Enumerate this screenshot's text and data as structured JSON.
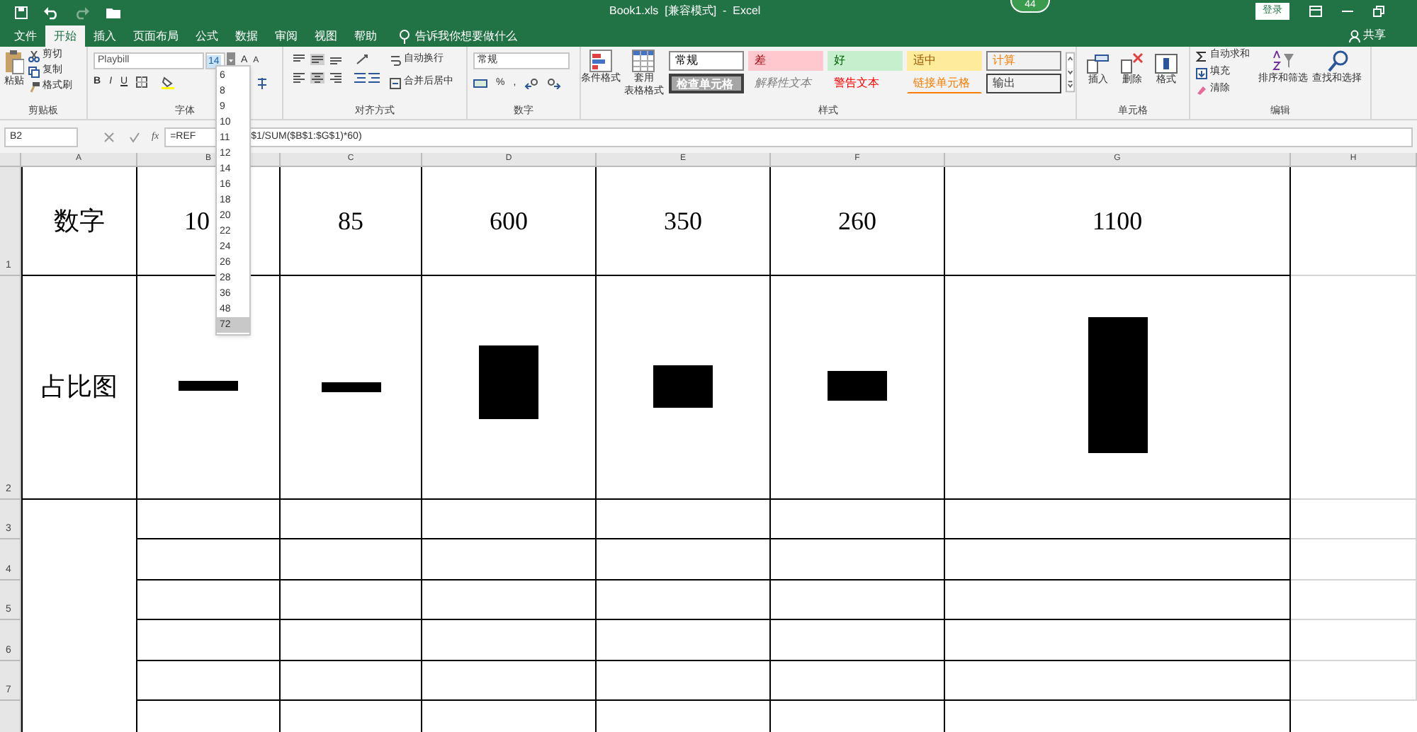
{
  "title_bar": {
    "title": "Book1.xls  [兼容模式]  -  Excel",
    "badge": "44",
    "sign_in": "登录"
  },
  "tabs": [
    {
      "label": "文件",
      "selected": false
    },
    {
      "label": "开始",
      "selected": true
    },
    {
      "label": "插入",
      "selected": false
    },
    {
      "label": "页面布局",
      "selected": false
    },
    {
      "label": "公式",
      "selected": false
    },
    {
      "label": "数据",
      "selected": false
    },
    {
      "label": "审阅",
      "selected": false
    },
    {
      "label": "视图",
      "selected": false
    },
    {
      "label": "帮助",
      "selected": false
    }
  ],
  "tell_me": {
    "placeholder": "告诉我你想要做什么"
  },
  "share": "共享",
  "ribbon": {
    "clipboard": {
      "label": "剪贴板",
      "paste": "粘贴",
      "cut": "剪切",
      "copy": "复制",
      "format_painter": "格式刷"
    },
    "font": {
      "label": "字体",
      "font_name": "Playbill",
      "font_size": "14",
      "bold": "B",
      "italic": "I",
      "underline": "U",
      "grow": "A",
      "shrink": "A"
    },
    "alignment": {
      "label": "对齐方式",
      "wrap": "自动换行",
      "merge": "合并后居中"
    },
    "number": {
      "label": "数字",
      "format": "常规",
      "percent": "%",
      "comma": ","
    },
    "styles": {
      "label": "样式",
      "conditional": "条件格式",
      "table_line1": "套用",
      "table_line2": "表格格式",
      "gallery": [
        {
          "label": "常规",
          "kind": "normal"
        },
        {
          "label": "差",
          "kind": "bad"
        },
        {
          "label": "好",
          "kind": "good"
        },
        {
          "label": "适中",
          "kind": "neutral"
        },
        {
          "label": "计算",
          "kind": "calculation"
        },
        {
          "label": "检查单元格",
          "kind": "check"
        },
        {
          "label": "解释性文本",
          "kind": "explanatory"
        },
        {
          "label": "警告文本",
          "kind": "warning"
        },
        {
          "label": "链接单元格",
          "kind": "linked"
        },
        {
          "label": "输出",
          "kind": "output"
        }
      ]
    },
    "cells": {
      "label": "单元格",
      "insert": "插入",
      "delete": "删除",
      "format": "格式"
    },
    "editing": {
      "label": "编辑",
      "autosum": "自动求和",
      "fill": "填充",
      "clear": "清除",
      "sort": "排序和筛选",
      "find": "查找和选择"
    }
  },
  "font_size_list": [
    {
      "label": "6",
      "selected": false
    },
    {
      "label": "8",
      "selected": false
    },
    {
      "label": "9",
      "selected": false
    },
    {
      "label": "10",
      "selected": false
    },
    {
      "label": "11",
      "selected": false
    },
    {
      "label": "12",
      "selected": false
    },
    {
      "label": "14",
      "selected": false
    },
    {
      "label": "16",
      "selected": false
    },
    {
      "label": "18",
      "selected": false
    },
    {
      "label": "20",
      "selected": false
    },
    {
      "label": "22",
      "selected": false
    },
    {
      "label": "24",
      "selected": false
    },
    {
      "label": "26",
      "selected": false
    },
    {
      "label": "28",
      "selected": false
    },
    {
      "label": "36",
      "selected": false
    },
    {
      "label": "48",
      "selected": false
    },
    {
      "label": "72",
      "selected": true
    }
  ],
  "formula_bar": {
    "name_box": "B2",
    "fx": "fx",
    "formula_start": "=REF",
    "formula_end": "$1/SUM($B$1:$G$1)*60)"
  },
  "sheet": {
    "columns": [
      "A",
      "B",
      "C",
      "D",
      "E",
      "F",
      "G",
      "H"
    ],
    "rows": [
      {
        "number": "1",
        "cells": [
          "数字",
          "10",
          "85",
          "600",
          "350",
          "260",
          "1100"
        ]
      },
      {
        "number": "2",
        "label": "占比图"
      },
      {
        "number": "3"
      },
      {
        "number": "4"
      },
      {
        "number": "5"
      },
      {
        "number": "6"
      },
      {
        "number": "7"
      }
    ]
  }
}
